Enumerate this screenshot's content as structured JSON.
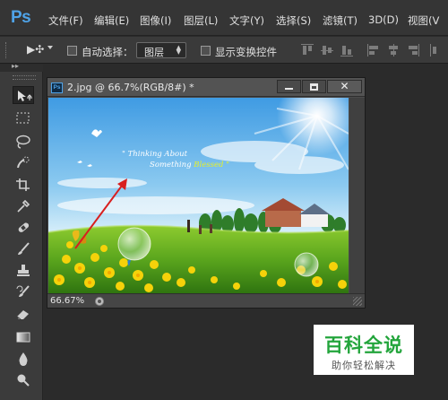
{
  "app": {
    "logo": "Ps"
  },
  "menu": [
    {
      "label": "文件(F)"
    },
    {
      "label": "编辑(E)"
    },
    {
      "label": "图像(I)"
    },
    {
      "label": "图层(L)"
    },
    {
      "label": "文字(Y)"
    },
    {
      "label": "选择(S)"
    },
    {
      "label": "滤镜(T)"
    },
    {
      "label": "3D(D)"
    },
    {
      "label": "视图(V"
    }
  ],
  "options": {
    "tool_glyph": "▶✣",
    "auto_select_label": "自动选择：",
    "auto_select_checked": false,
    "auto_select_value": "图层",
    "show_transform_label": "显示变换控件",
    "show_transform_checked": false
  },
  "tools": [
    "move-tool-icon",
    "marquee-tool-icon",
    "lasso-tool-icon",
    "quick-selection-tool-icon",
    "crop-tool-icon",
    "eyedropper-tool-icon",
    "healing-brush-tool-icon",
    "brush-tool-icon",
    "clone-stamp-tool-icon",
    "history-brush-tool-icon",
    "eraser-tool-icon",
    "gradient-tool-icon",
    "blur-tool-icon",
    "dodge-tool-icon"
  ],
  "document": {
    "badge": "Ps",
    "title": "2.jpg @ 66.7%(RGB/8#) *",
    "zoom": "66.67%",
    "image_text_line1": "\" Thinking About",
    "image_text_line2": "Something",
    "image_text_highlight": "Blessed \""
  },
  "watermark": {
    "title": "百科全说",
    "subtitle": "助你轻松解决"
  },
  "colors": {
    "accent": "#4fa3e8",
    "watermark_green": "#23a53c",
    "annotation_arrow": "#d81f1f"
  }
}
